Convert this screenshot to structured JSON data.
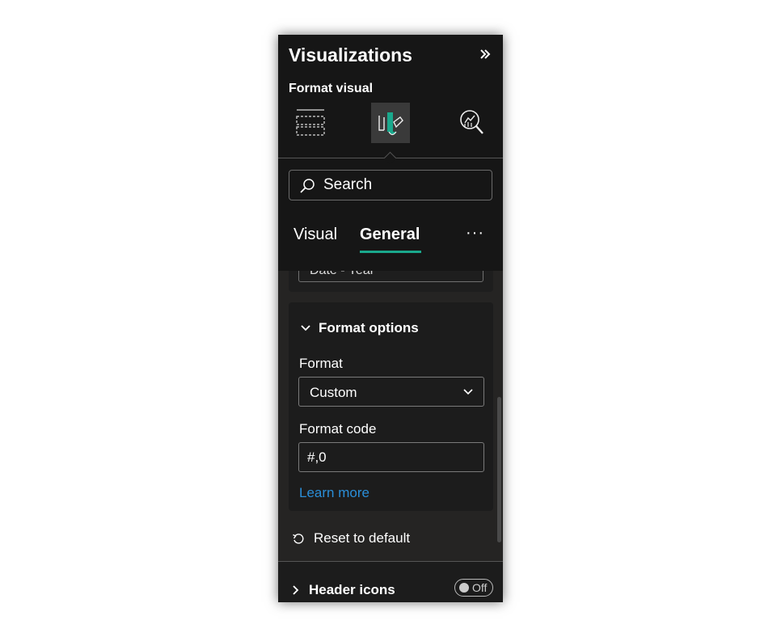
{
  "panel": {
    "title": "Visualizations",
    "subtitle": "Format visual"
  },
  "icons": {
    "collapse": "double-chevron-right-icon",
    "build_visual": "build-visual-icon",
    "format_visual": "format-paintbrush-icon",
    "analytics": "analytics-magnifier-icon",
    "search": "search-icon"
  },
  "search": {
    "placeholder": "Search"
  },
  "tabs": [
    {
      "label": "Visual",
      "active": false
    },
    {
      "label": "General",
      "active": true
    }
  ],
  "more_label": "···",
  "previous_field_value": "Date - Year",
  "format_options": {
    "header": "Format options",
    "format_label": "Format",
    "format_value": "Custom",
    "format_code_label": "Format code",
    "format_code_value": "#,0",
    "learn_more": "Learn more"
  },
  "reset_label": "Reset to default",
  "header_icons": {
    "label": "Header icons",
    "toggle_label": "Off",
    "toggle_on": false
  },
  "colors": {
    "panel_bg": "#252423",
    "accent": "#1aa88c",
    "link": "#2a8ed8"
  }
}
